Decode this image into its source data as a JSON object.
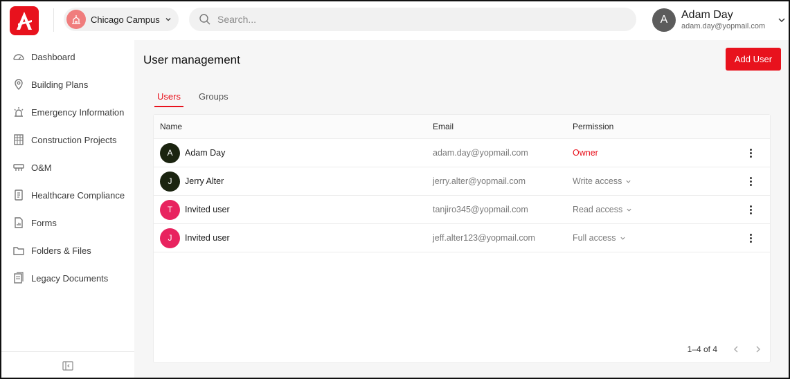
{
  "header": {
    "campus": "Chicago Campus",
    "search_placeholder": "Search...",
    "user_name": "Adam Day",
    "user_email": "adam.day@yopmail.com",
    "user_initial": "A"
  },
  "sidebar": {
    "items": [
      {
        "label": "Dashboard",
        "icon": "gauge-icon"
      },
      {
        "label": "Building Plans",
        "icon": "location-pin-icon"
      },
      {
        "label": "Emergency Information",
        "icon": "siren-icon"
      },
      {
        "label": "Construction Projects",
        "icon": "construction-icon"
      },
      {
        "label": "O&M",
        "icon": "maintenance-icon"
      },
      {
        "label": "Healthcare Compliance",
        "icon": "clipboard-icon"
      },
      {
        "label": "Forms",
        "icon": "form-chart-icon"
      },
      {
        "label": "Folders & Files",
        "icon": "folder-icon"
      },
      {
        "label": "Legacy Documents",
        "icon": "documents-icon"
      }
    ]
  },
  "main": {
    "title": "User management",
    "add_user_label": "Add User",
    "tabs": [
      {
        "label": "Users",
        "active": true
      },
      {
        "label": "Groups",
        "active": false
      }
    ],
    "columns": {
      "name": "Name",
      "email": "Email",
      "permission": "Permission"
    },
    "rows": [
      {
        "initial": "A",
        "name": "Adam Day",
        "email": "adam.day@yopmail.com",
        "permission": "Owner",
        "avatar_color": "#1b2410",
        "perm_color": "#e8121d",
        "dropdown": false
      },
      {
        "initial": "J",
        "name": "Jerry Alter",
        "email": "jerry.alter@yopmail.com",
        "permission": "Write access",
        "avatar_color": "#1b2410",
        "perm_color": "#7a7a7a",
        "dropdown": true
      },
      {
        "initial": "T",
        "name": "Invited user",
        "email": "tanjiro345@yopmail.com",
        "permission": "Read access",
        "avatar_color": "#e8235f",
        "perm_color": "#7a7a7a",
        "dropdown": true
      },
      {
        "initial": "J",
        "name": "Invited user",
        "email": "jeff.alter123@yopmail.com",
        "permission": "Full access",
        "avatar_color": "#e8235f",
        "perm_color": "#7a7a7a",
        "dropdown": true
      }
    ],
    "pagination": "1–4 of 4"
  },
  "colors": {
    "accent": "#e8121d"
  }
}
